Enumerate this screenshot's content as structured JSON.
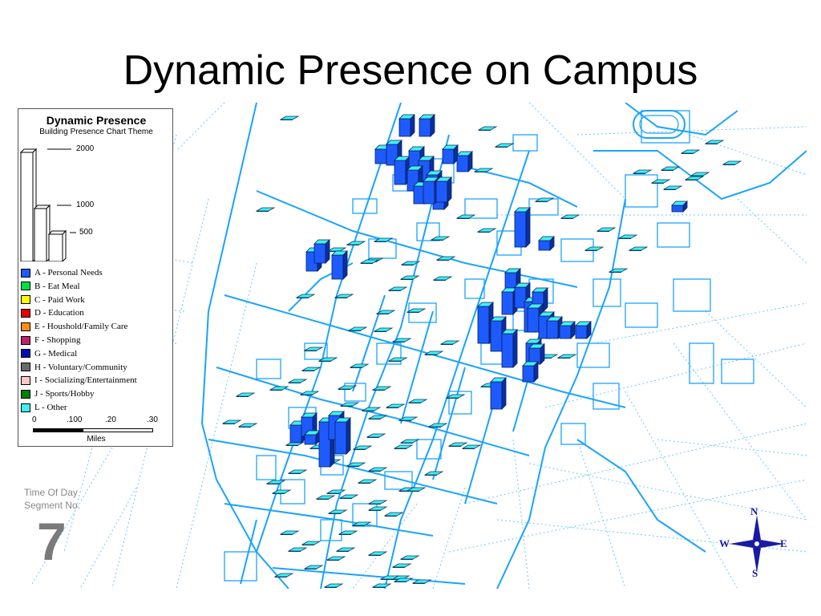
{
  "slide": {
    "title": "Dynamic Presence on Campus"
  },
  "legend": {
    "title": "Dynamic Presence",
    "subtitle": "Building Presence Chart Theme",
    "scale_values": [
      {
        "label": "2000",
        "value": 2000
      },
      {
        "label": "1000",
        "value": 1000
      },
      {
        "label": "500",
        "value": 500
      }
    ],
    "categories": [
      {
        "label": "A - Personal Needs",
        "color": "#1e5bff"
      },
      {
        "label": "B - Eat Meal",
        "color": "#00e040"
      },
      {
        "label": "C - Paid Work",
        "color": "#ffff00"
      },
      {
        "label": "D - Education",
        "color": "#e00000"
      },
      {
        "label": "E - Houshold/Family Care",
        "color": "#ff8c1a"
      },
      {
        "label": "F - Shopping",
        "color": "#c0206a"
      },
      {
        "label": "G - Medical",
        "color": "#0010b0"
      },
      {
        "label": "H - Voluntary/Community",
        "color": "#6a6a6a"
      },
      {
        "label": "I - Socializing/Entertainment",
        "color": "#ffc8c8"
      },
      {
        "label": "J - Sports/Hobby",
        "color": "#008000"
      },
      {
        "label": "L - Other",
        "color": "#40f0f0"
      }
    ],
    "scalebar": {
      "ticks": [
        "0",
        ".100",
        ".20",
        ".30"
      ],
      "unit": "Miles"
    }
  },
  "time_of_day": {
    "label_line1": "Time Of Day",
    "label_line2": "Segment No.",
    "value": "7"
  },
  "compass": {
    "n": "N",
    "s": "S",
    "e": "E",
    "w": "W"
  },
  "map": {
    "road_color": "#1aa3ff",
    "street_color": "#6fc6ff",
    "bar_front": "#1e5bff",
    "bar_side": "#0a2f9e",
    "bar_top": "#40f0f0"
  }
}
